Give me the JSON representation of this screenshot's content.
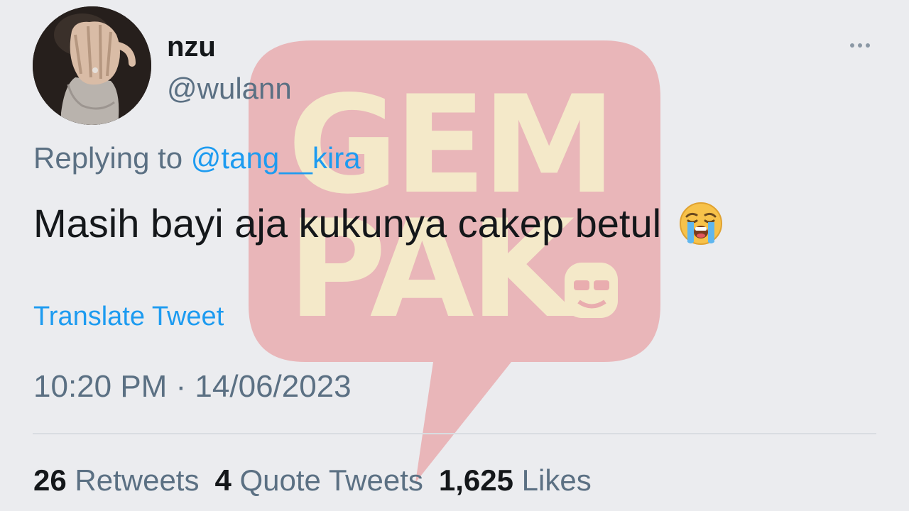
{
  "tweet": {
    "author": {
      "display_name": "nzu",
      "handle": "@wulann"
    },
    "reply_prefix": "Replying to",
    "reply_to": "@tang__kira",
    "text": "Masih bayi aja kukunya cakep betul",
    "emoji": "loudly-crying-face",
    "translate_label": "Translate Tweet",
    "timestamp": "10:20 PM · 14/06/2023"
  },
  "stats": [
    {
      "count": "26",
      "label": "Retweets"
    },
    {
      "count": "4",
      "label": "Quote Tweets"
    },
    {
      "count": "1,625",
      "label": "Likes"
    }
  ],
  "watermark": {
    "line1": "GEM",
    "line2": "PAK",
    "color": "#e05a5f"
  },
  "colors": {
    "background": "#ebecef",
    "link": "#1d9bf0",
    "secondary_text": "#5b7083",
    "primary_text": "#14171a"
  },
  "icons": {
    "more": "more-horizontal-icon"
  }
}
